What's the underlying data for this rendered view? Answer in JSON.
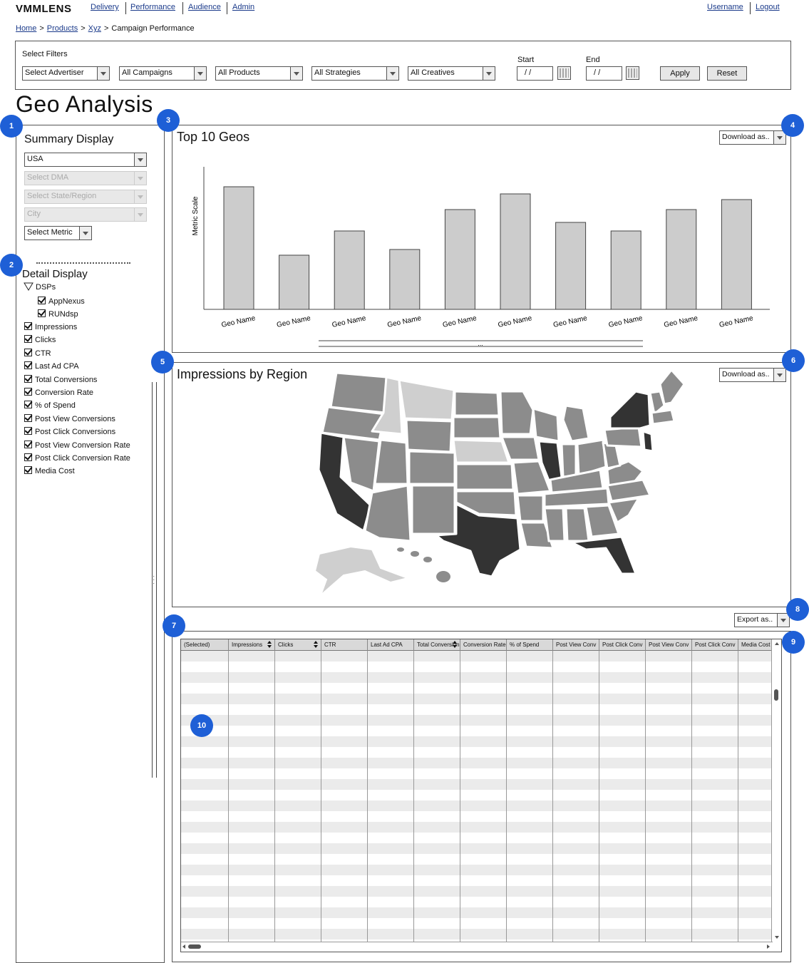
{
  "app": {
    "logo": "VMMLENS"
  },
  "nav": {
    "items": [
      "Delivery",
      "Performance",
      "Audience",
      "Admin"
    ],
    "username": "Username",
    "logout": "Logout"
  },
  "breadcrumb": {
    "items": [
      "Home",
      "Products",
      "Xyz"
    ],
    "current": "Campaign Performance",
    "separator": ">"
  },
  "filters": {
    "label": "Select Filters",
    "advertiser": "Select Advertiser",
    "campaigns": "All Campaigns",
    "products": "All Products",
    "strategies": "All Strategies",
    "creatives": "All Creatives",
    "start_label": "Start",
    "start_value": "/ /",
    "end_label": "End",
    "end_value": "/ /",
    "apply": "Apply",
    "reset": "Reset"
  },
  "page": {
    "title": "Geo Analysis"
  },
  "markers": [
    "1",
    "2",
    "3",
    "4",
    "5",
    "6",
    "7",
    "8",
    "9",
    "10"
  ],
  "summary": {
    "title": "Summary Display",
    "country": "USA",
    "dma": "Select DMA",
    "state": "Select State/Region",
    "city": "City",
    "metric": "Select Metric"
  },
  "detail": {
    "title": "Detail Display",
    "group": "DSPs",
    "dsps": [
      "AppNexus",
      "RUNdsp"
    ],
    "metrics": [
      "Impressions",
      "Clicks",
      "CTR",
      "Last Ad CPA",
      "Total Conversions",
      "Conversion Rate",
      "% of Spend",
      "Post View Conversions",
      "Post Click Conversions",
      "Post View Conversion Rate",
      "Post Click Conversion Rate",
      "Media Cost"
    ]
  },
  "top_geos": {
    "title": "Top 10 Geos",
    "download": "Download as..",
    "more": "..."
  },
  "chart_data": {
    "type": "bar",
    "ylabel": "Metric Scale",
    "xlabel": "",
    "categories": [
      "Geo Name",
      "Geo Name",
      "Geo Name",
      "Geo Name",
      "Geo Name",
      "Geo Name",
      "Geo Name",
      "Geo Name",
      "Geo Name",
      "Geo Name"
    ],
    "values": [
      86,
      38,
      55,
      42,
      70,
      81,
      61,
      55,
      70,
      77
    ],
    "ylim": [
      0,
      100
    ],
    "colors": {
      "bar": "#cccccc",
      "bar_stroke": "#444444"
    }
  },
  "map": {
    "title": "Impressions by Region",
    "download": "Download as..",
    "colors": {
      "dark": "#333333",
      "mid": "#8c8c8c",
      "light": "#cfcfcf"
    }
  },
  "table": {
    "export": "Export as..",
    "columns": [
      "(Selected)",
      "Impressions",
      "Clicks",
      "CTR",
      "Last Ad CPA",
      "Total Conversions",
      "Conversion Rate",
      "% of Spend",
      "Post View Conv",
      "Post Click Conv",
      "Post View Conv",
      "Post Click Conv",
      "Media Cost"
    ]
  }
}
